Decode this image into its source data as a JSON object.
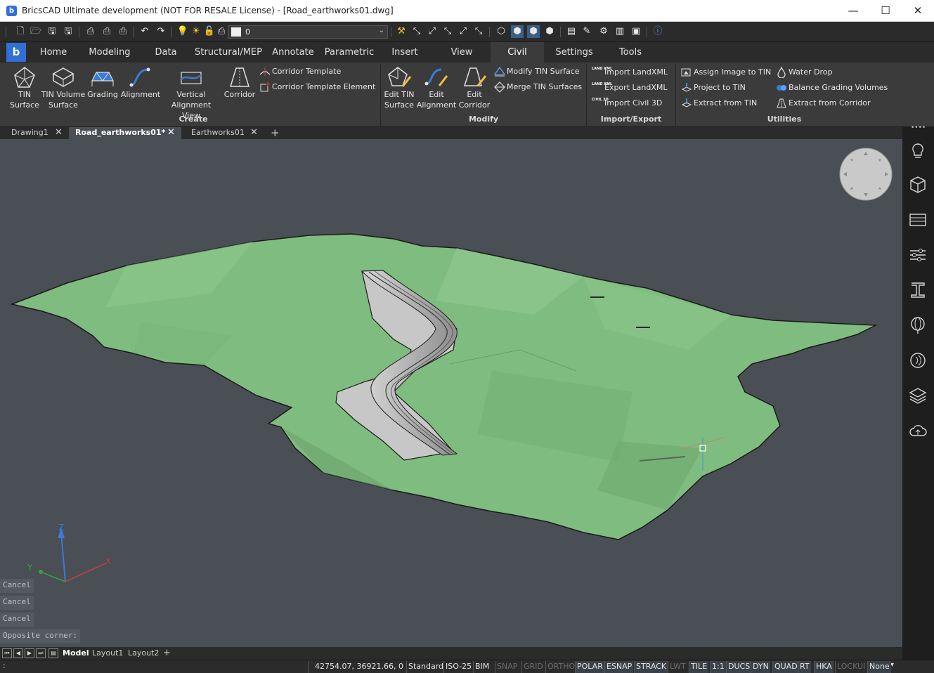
{
  "window": {
    "title": "BricsCAD Ultimate development (NOT FOR RESALE License) - [Road_earthworks01.dwg]",
    "minimize": "—",
    "maximize": "☐",
    "close": "✕"
  },
  "quickbar": {
    "layer_value": "0"
  },
  "ribbon_tabs": [
    "Home",
    "Modeling",
    "Data",
    "Structural/MEP",
    "Annotate",
    "Parametric",
    "Insert",
    "View",
    "Civil",
    "Settings",
    "Tools"
  ],
  "active_ribbon_tab": "Civil",
  "ribbon": {
    "create": {
      "title": "Create",
      "tin_surface": [
        "TIN",
        "Surface"
      ],
      "tin_volume_surface": [
        "TIN Volume",
        "Surface"
      ],
      "grading": "Grading",
      "alignment": "Alignment",
      "vertical_alignment_view": [
        "Vertical",
        "Alignment View"
      ],
      "corridor": "Corridor",
      "corridor_template": "Corridor Template",
      "corridor_template_element": "Corridor Template Element"
    },
    "modify": {
      "title": "Modify",
      "edit_tin_surface": [
        "Edit TIN",
        "Surface"
      ],
      "edit_alignment": [
        "Edit",
        "Alignment"
      ],
      "edit_corridor": [
        "Edit",
        "Corridor"
      ],
      "modify_tin_surface": "Modify TIN Surface",
      "merge_tin_surfaces": "Merge TIN Surfaces"
    },
    "import_export": {
      "title": "Import/Export",
      "import_landxml": "Import LandXML",
      "export_landxml": "Export LandXML",
      "import_civil3d": "Import Civil 3D",
      "landxml_badge": "LAND XML",
      "civil3d_badge": "CIVIL 3D"
    },
    "utilities": {
      "title": "Utilities",
      "assign_image_to_tin": "Assign Image to TIN",
      "project_to_tin": "Project to TIN",
      "extract_from_tin": "Extract from TIN",
      "water_drop": "Water Drop",
      "balance_grading_volumes": "Balance Grading Volumes",
      "extract_from_corridor": "Extract from Corridor"
    }
  },
  "document_tabs": [
    {
      "label": "Drawing1",
      "active": false
    },
    {
      "label": "Road_earthworks01*",
      "active": true
    },
    {
      "label": "Earthworks01",
      "active": false
    }
  ],
  "new_tab_symbol": "+",
  "close_symbol": "✕",
  "command_history": [
    "Cancel",
    "Cancel",
    "Cancel",
    "Opposite corner:"
  ],
  "ucs": {
    "x": "X",
    "y": "Y",
    "z": "Z"
  },
  "layout_tabs": [
    {
      "label": "Model",
      "active": true
    },
    {
      "label": "Layout1",
      "active": false
    },
    {
      "label": "Layout2",
      "active": false
    }
  ],
  "layout_add": "+",
  "status": {
    "coordinates": "42754.07, 36921.66, 0",
    "text_style": "Standard",
    "dim_style": "ISO-25",
    "workspace": "BIM",
    "toggles": [
      {
        "label": "SNAP",
        "on": false
      },
      {
        "label": "GRID",
        "on": false
      },
      {
        "label": "ORTHO",
        "on": false
      },
      {
        "label": "POLAR",
        "on": true
      },
      {
        "label": "ESNAP",
        "on": true
      },
      {
        "label": "STRACK",
        "on": true
      },
      {
        "label": "LWT",
        "on": false
      },
      {
        "label": "TILE",
        "on": true
      },
      {
        "label": "1:1",
        "on": true
      },
      {
        "label": "DUCS",
        "on": true
      },
      {
        "label": "DYN",
        "on": true
      },
      {
        "label": "QUAD",
        "on": true
      },
      {
        "label": "RT",
        "on": true
      },
      {
        "label": "HKA",
        "on": true
      },
      {
        "label": "LOCKUI",
        "on": false
      },
      {
        "label": "None",
        "on": true
      }
    ]
  },
  "colors": {
    "terrain": "#7fbc7f",
    "viewport_bg": "#4a4e55",
    "accent": "#2f6fd6"
  }
}
